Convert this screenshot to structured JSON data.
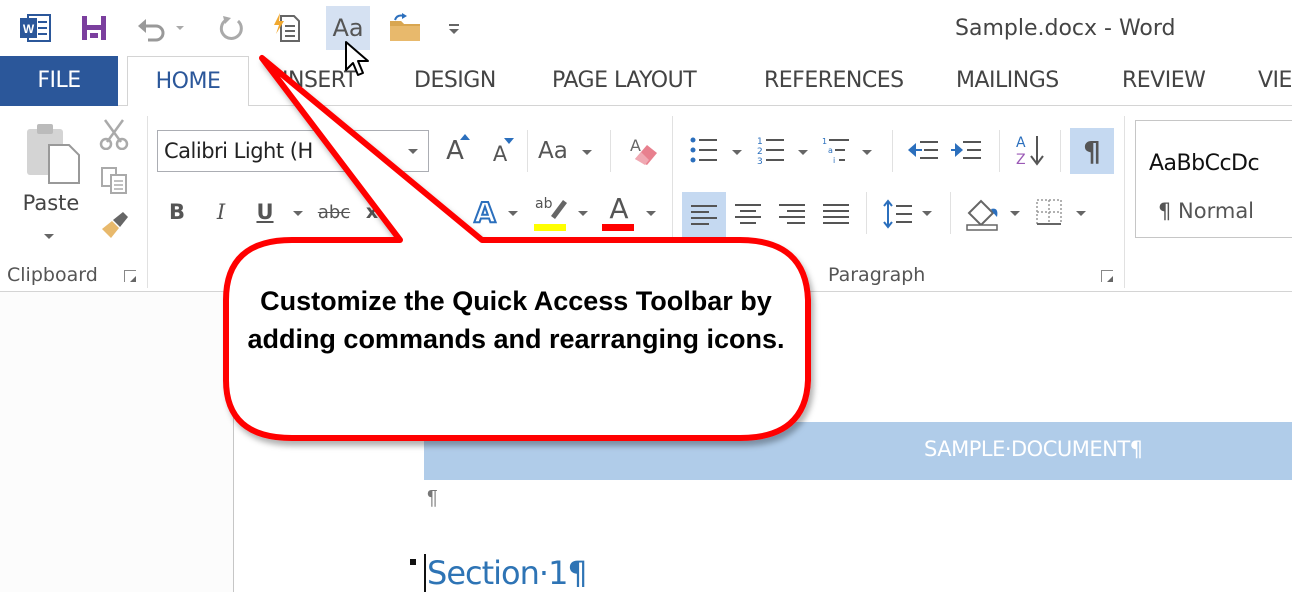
{
  "window": {
    "title": "Sample.docx - Word"
  },
  "qat": {
    "items": [
      {
        "name": "word-logo-icon"
      },
      {
        "name": "save-icon"
      },
      {
        "name": "undo-icon"
      },
      {
        "name": "redo-icon"
      },
      {
        "name": "quick-print-icon"
      },
      {
        "name": "change-case-icon",
        "label": "Aa",
        "highlighted": true
      },
      {
        "name": "open-folder-icon"
      },
      {
        "name": "customize-qat-icon"
      }
    ]
  },
  "tabs": [
    {
      "label": "FILE",
      "active": false
    },
    {
      "label": "HOME",
      "active": true
    },
    {
      "label": "INSERT",
      "active": false
    },
    {
      "label": "DESIGN",
      "active": false
    },
    {
      "label": "PAGE LAYOUT",
      "active": false
    },
    {
      "label": "REFERENCES",
      "active": false
    },
    {
      "label": "MAILINGS",
      "active": false
    },
    {
      "label": "REVIEW",
      "active": false
    },
    {
      "label": "VIE",
      "active": false
    }
  ],
  "ribbon": {
    "clipboard": {
      "label": "Clipboard",
      "paste_label": "Paste"
    },
    "font": {
      "font_name": "Calibri Light (H",
      "bold": "B",
      "italic": "I",
      "underline": "U",
      "strikethrough": "abc",
      "subscript": "x",
      "grow": "A",
      "shrink": "A",
      "change_case": "Aa",
      "text_effects": "A",
      "highlight": "ab",
      "font_color": "A",
      "highlight_color": "#ffff00",
      "font_color_value": "#ff0000"
    },
    "paragraph": {
      "label": "Paragraph",
      "show_marks": "¶",
      "align_left_active": true
    },
    "styles": {
      "sample": "AaBbCcDc",
      "name": "¶ Normal"
    }
  },
  "callout": {
    "text": "Customize the Quick Access Toolbar by adding commands and rearranging icons.",
    "border_color": "#ff0000"
  },
  "document": {
    "banner": "SAMPLE·DOCUMENT¶",
    "para_mark": "¶",
    "heading": "Section·1¶"
  }
}
